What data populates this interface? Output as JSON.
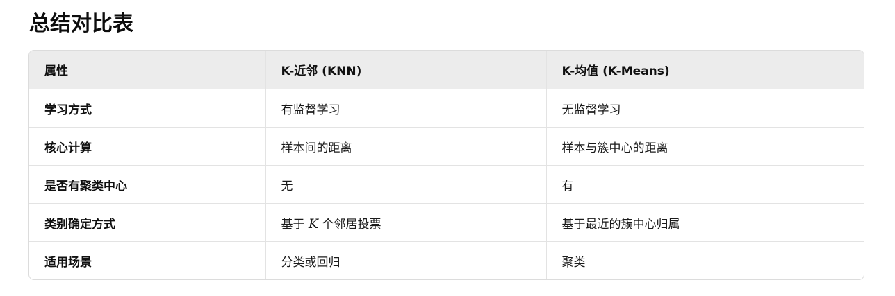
{
  "title": "总结对比表",
  "table": {
    "headers": [
      "属性",
      "K-近邻 (KNN)",
      "K-均值 (K-Means)"
    ],
    "rows": [
      {
        "attribute": "学习方式",
        "knn": "有监督学习",
        "kmeans": "无监督学习"
      },
      {
        "attribute": "核心计算",
        "knn": "样本间的距离",
        "kmeans": "样本与簇中心的距离"
      },
      {
        "attribute": "是否有聚类中心",
        "knn": "无",
        "kmeans": "有"
      },
      {
        "attribute": "类别确定方式",
        "knn_prefix": "基于",
        "knn_math": "K",
        "knn_suffix": "个邻居投票",
        "kmeans": "基于最近的簇中心归属"
      },
      {
        "attribute": "适用场景",
        "knn": "分类或回归",
        "kmeans": "聚类"
      }
    ]
  }
}
